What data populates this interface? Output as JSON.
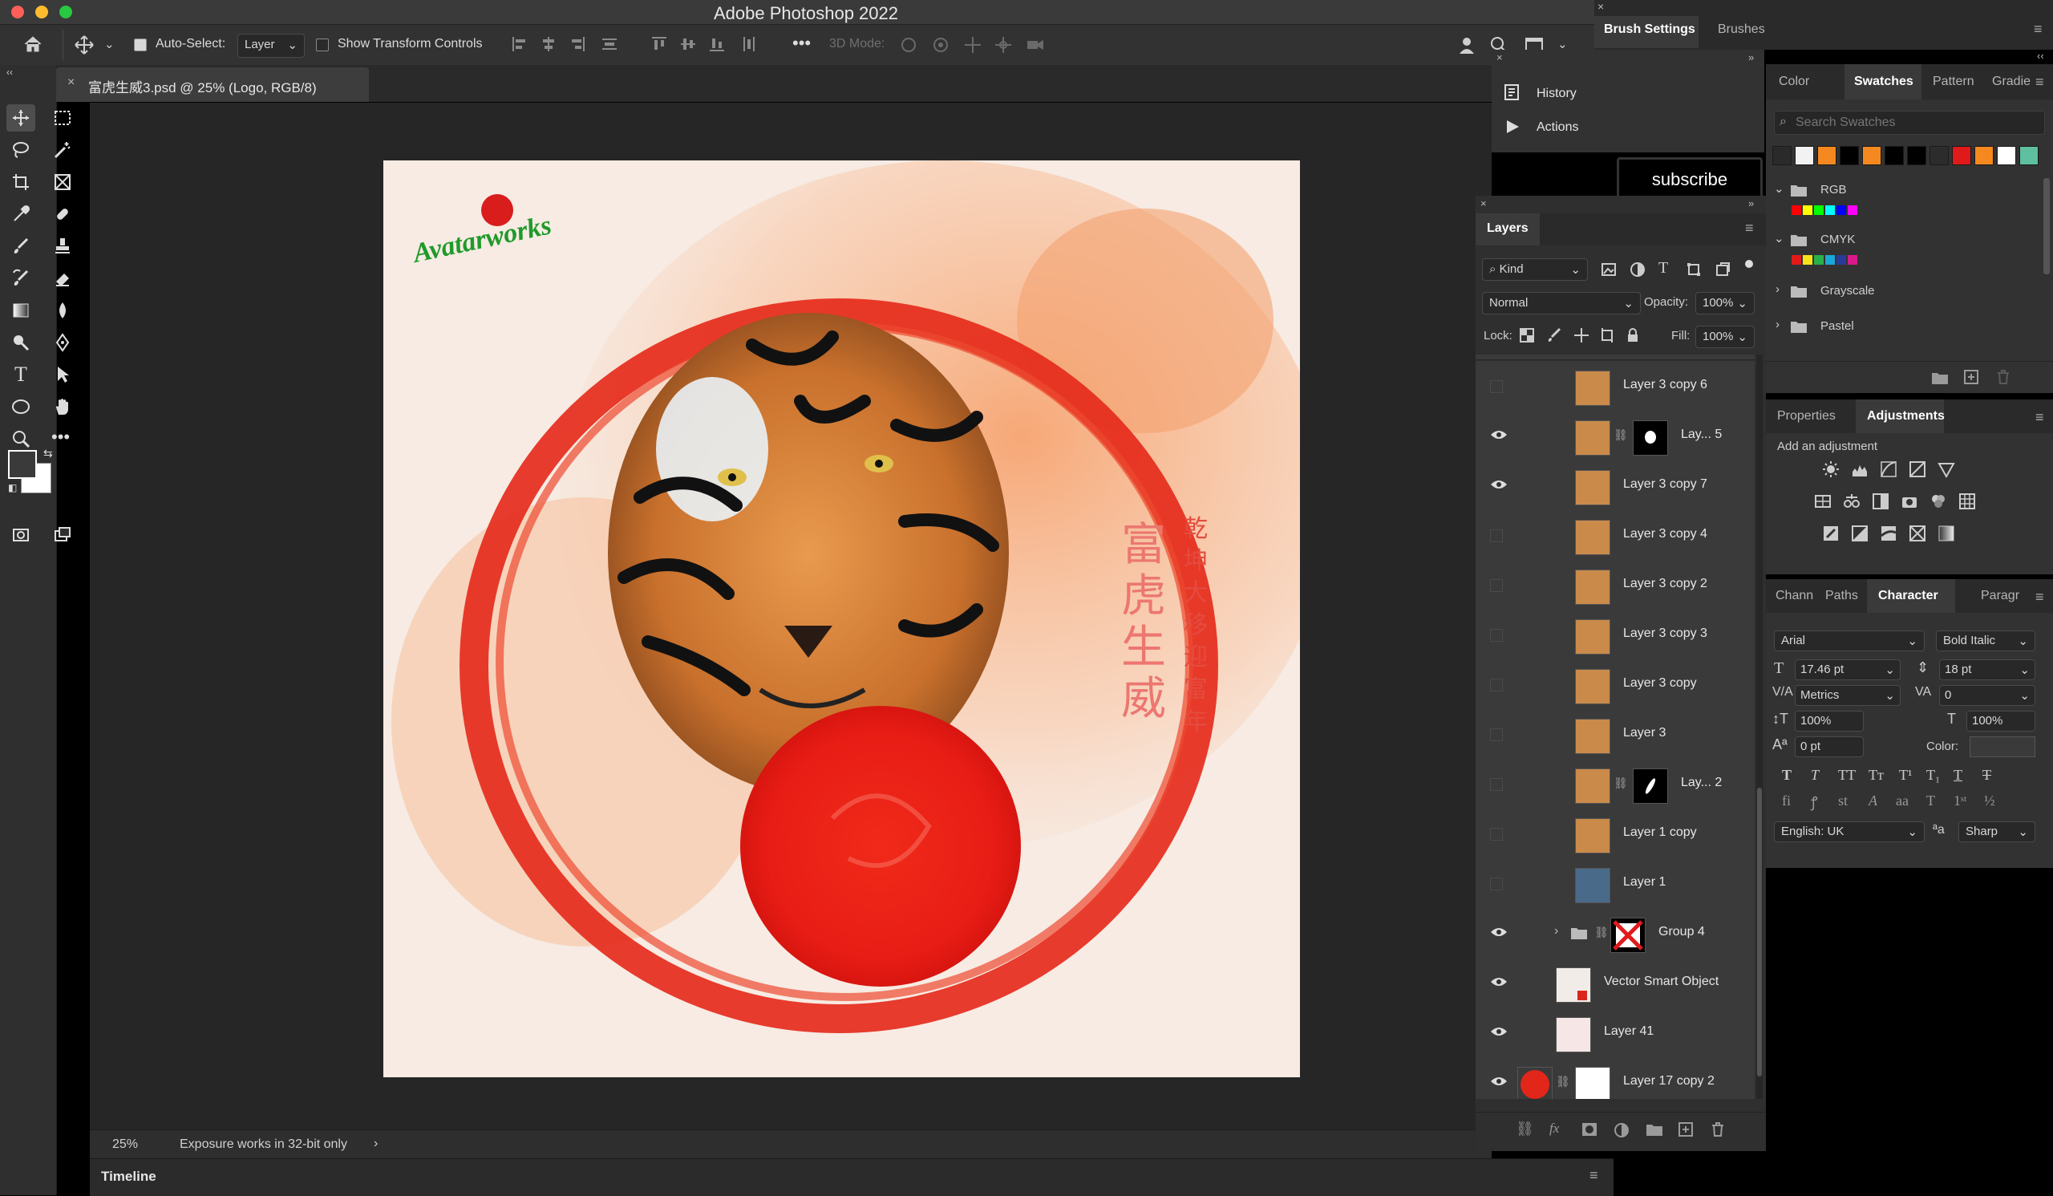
{
  "app": {
    "title": "Adobe Photoshop 2022"
  },
  "options": {
    "auto_select_label": "Auto-Select:",
    "auto_select_value": "Layer",
    "transform_label": "Show Transform Controls",
    "three_d_label": "3D Mode:"
  },
  "document": {
    "tab_title": "富虎生威3.psd @ 25% (Logo, RGB/8)",
    "zoom": "25%",
    "status": "Exposure works in 32-bit only"
  },
  "artwork": {
    "main_text": "富虎生威",
    "side_text": "乾坤大移迎富年",
    "signature": "Avatarworks"
  },
  "timeline": {
    "label": "Timeline"
  },
  "brush_panel": {
    "tabs": [
      "Brush Settings",
      "Brushes"
    ]
  },
  "history_panel": {
    "history": "History",
    "actions": "Actions",
    "subscribe": "subscribe"
  },
  "layers_panel": {
    "title": "Layers",
    "kind": "Kind",
    "blend": "Normal",
    "opacity_label": "Opacity:",
    "opacity": "100%",
    "lock_label": "Lock:",
    "fill_label": "Fill:",
    "fill": "100%",
    "layers": [
      {
        "name": "Layer 3 copy 6"
      },
      {
        "name": "Lay... 5"
      },
      {
        "name": "Layer 3 copy 7"
      },
      {
        "name": "Layer 3 copy 4"
      },
      {
        "name": "Layer 3 copy 2"
      },
      {
        "name": "Layer 3 copy 3"
      },
      {
        "name": "Layer 3 copy"
      },
      {
        "name": "Layer 3"
      },
      {
        "name": "Lay... 2"
      },
      {
        "name": "Layer 1 copy"
      },
      {
        "name": "Layer 1"
      },
      {
        "name": "Group 4"
      },
      {
        "name": "Vector Smart Object"
      },
      {
        "name": "Layer 41"
      },
      {
        "name": "Layer 17 copy 2"
      }
    ]
  },
  "swatches_panel": {
    "tabs": [
      "Color",
      "Swatches",
      "Pattern",
      "Gradie"
    ],
    "search_placeholder": "Search Swatches",
    "colors": [
      "#f2f2f2",
      "#f5891f",
      "#000000",
      "#f5891f",
      "#000000",
      "#000000",
      "#2c2c2c",
      "#e01a1a",
      "#f5891f",
      "#ffffff",
      "#5ec0a0"
    ],
    "groups": [
      "RGB",
      "CMYK",
      "Grayscale",
      "Pastel"
    ]
  },
  "adjust_panel": {
    "tabs": [
      "Properties",
      "Adjustments"
    ],
    "add_label": "Add an adjustment"
  },
  "character_panel": {
    "tabs": [
      "Chann",
      "Paths",
      "Character",
      "Paragr"
    ],
    "font": "Arial",
    "style": "Bold Italic",
    "size": "17.46 pt",
    "leading": "18 pt",
    "kerning": "Metrics",
    "tracking": "0",
    "vscale": "100%",
    "hscale": "100%",
    "baseline": "0 pt",
    "color_label": "Color:",
    "language": "English: UK",
    "aa": "Sharp"
  }
}
